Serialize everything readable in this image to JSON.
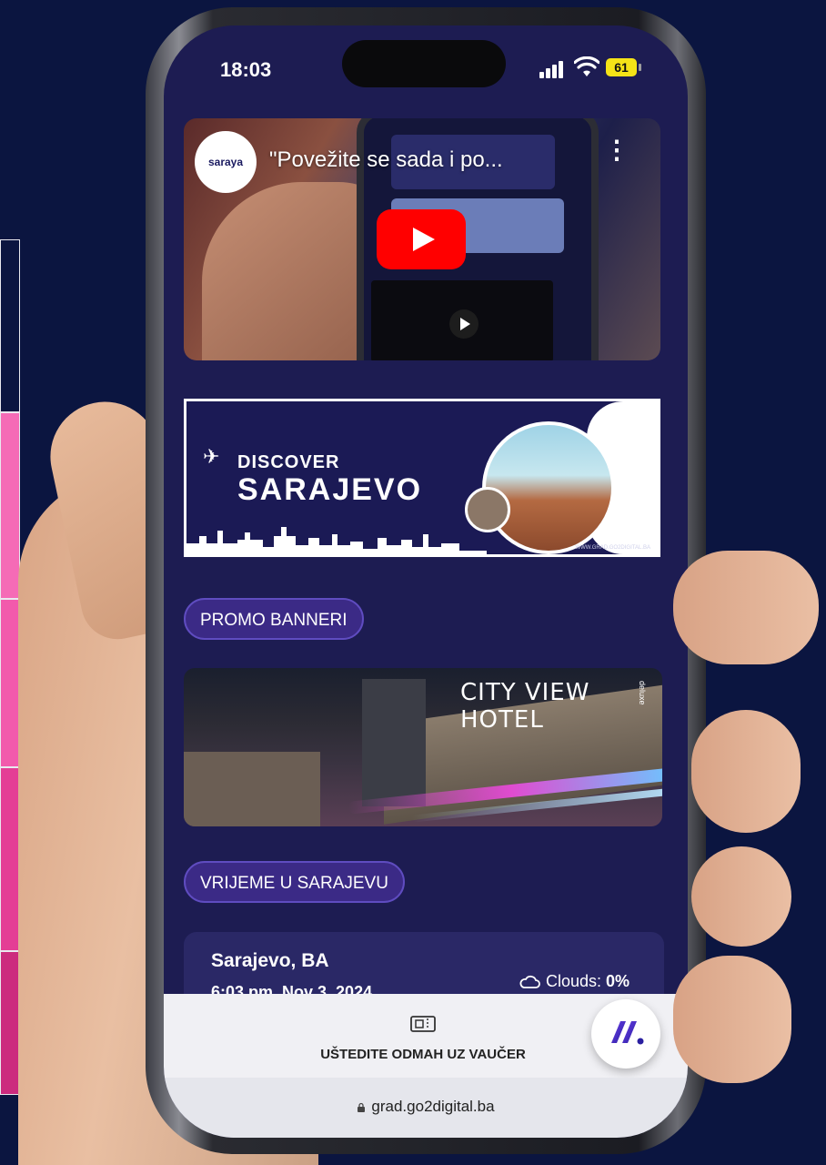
{
  "status_bar": {
    "time": "18:03",
    "battery": "61"
  },
  "video": {
    "channel": "saraya",
    "title": "\"Povežite se sada i po...",
    "menu_icon": "more-vertical-icon",
    "play_icon": "youtube-play-icon"
  },
  "banner": {
    "line1": "DISCOVER",
    "line2": "SARAJEVO",
    "footer_url": "WWW.GRAD.GO2DIGITAL.BA"
  },
  "promo_section": {
    "label": "PROMO BANNERI"
  },
  "hotel_banner": {
    "name": "CITY VIEW HOTEL",
    "tag": "deluxe"
  },
  "weather_section": {
    "label": "VRIJEME U SARAJEVU"
  },
  "weather": {
    "city": "Sarajevo, BA",
    "datetime": "6:03 pm, Nov 3, 2024",
    "clouds_label": "Clouds:",
    "clouds_value": "0%"
  },
  "voucher": {
    "label": "UŠTEDITE ODMAH UZ VAUČER",
    "icon": "ticket-icon"
  },
  "browser": {
    "url": "grad.go2digital.ba"
  },
  "colors": {
    "screen_bg": "#1d1c52",
    "pill_bg": "#3b2a86",
    "accent_pink": "#f56bb6",
    "page_bg": "#0b1540"
  }
}
